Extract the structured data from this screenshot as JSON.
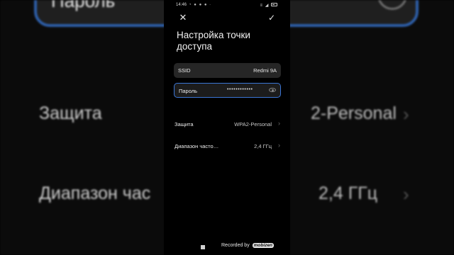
{
  "statusbar": {
    "time": "14:46",
    "left_icons": "◔ ● ● ● ·",
    "right_icons": "≡ ◢"
  },
  "header": {
    "close_icon": "✕",
    "save_icon": "✓",
    "title": "Настройка точки доступа"
  },
  "fields": {
    "ssid_label": "SSID",
    "ssid_value": "Redmi 9A",
    "password_label": "Пароль",
    "password_value": "••••••••••••"
  },
  "settings": {
    "security_label": "Защита",
    "security_value": "WPA2-Personal",
    "band_label": "Диапазон часто…",
    "band_value": "2,4 ГГц",
    "chevron": "›"
  },
  "background": {
    "password_label": "Пароль",
    "security_label": "Защита",
    "security_value": "2-Personal",
    "band_label": "Диапазон час",
    "band_value": "2,4 ГГц"
  },
  "watermark": {
    "text": "Recorded by",
    "brand": "mobizen"
  },
  "colors": {
    "accent": "#3b76d6",
    "field_background": "#262626",
    "background": "#000000"
  }
}
